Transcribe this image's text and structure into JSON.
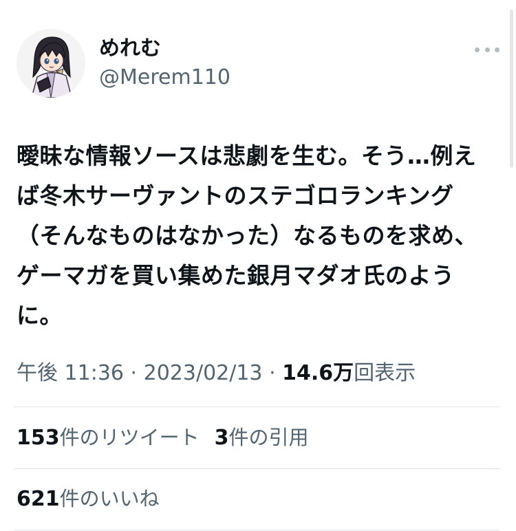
{
  "user": {
    "display_name": "めれむ",
    "handle": "@Merem110",
    "avatar_icon": "anime-avatar-icon"
  },
  "tweet": {
    "text": "曖昧な情報ソースは悲劇を生む。そう…例えば冬木サーヴァントのステゴロランキング（そんなものはなかった）なるものを求め、ゲーマガを買い集めた銀月マダオ氏のように。"
  },
  "meta": {
    "time": "午後 11:36",
    "sep1": " · ",
    "date": "2023/02/13",
    "sep2": " · ",
    "views_number": "14.6",
    "views_unit": "万",
    "views_label": "回表示"
  },
  "stats": {
    "retweets_count": "153",
    "retweets_label": "件のリツイート",
    "quotes_count": "3",
    "quotes_label": "件の引用",
    "likes_count": "621",
    "likes_label": "件のいいね"
  },
  "colors": {
    "text_primary": "#0f1419",
    "text_secondary": "#536471",
    "divider": "#e1e6ea"
  }
}
